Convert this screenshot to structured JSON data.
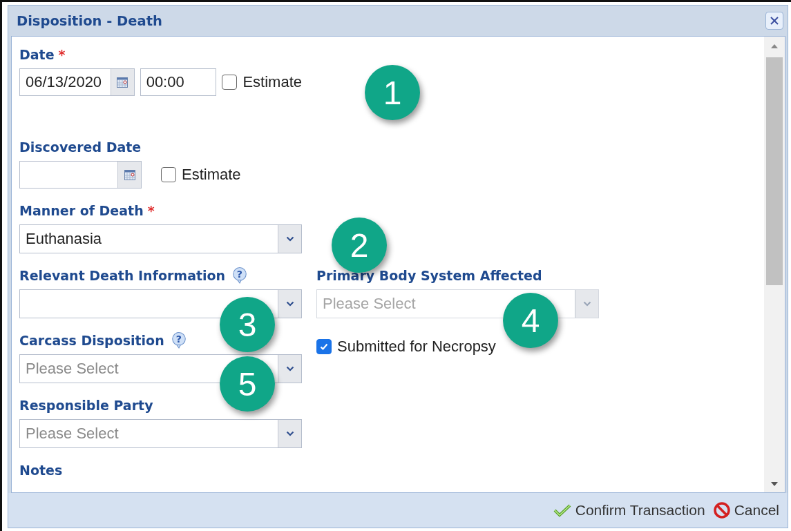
{
  "window": {
    "title": "Disposition - Death"
  },
  "rows": [
    {
      "fields": [
        {
          "kind": "datetime",
          "label": "Date",
          "required_mark": "*",
          "date": "06/13/2020",
          "time": "00:00",
          "estimate": {
            "label": "Estimate",
            "checked": false
          }
        }
      ]
    },
    {
      "fields": [
        {
          "kind": "date",
          "label": "Discovered Date",
          "estimate": {
            "label": "Estimate",
            "checked": false
          }
        }
      ]
    },
    {
      "fields": [
        {
          "kind": "select",
          "label": "Manner of Death",
          "required_mark": "*",
          "value": "Euthanasia",
          "disabled": false
        }
      ]
    },
    {
      "fields": [
        {
          "kind": "select",
          "label": "Relevant Death Information",
          "help": "?",
          "disabled": false
        },
        {
          "kind": "select",
          "label": "Primary Body System Affected",
          "placeholder": "Please Select",
          "disabled": true
        }
      ]
    },
    {
      "fields": [
        {
          "kind": "select",
          "label": "Carcass Disposition",
          "help": "?",
          "placeholder": "Please Select",
          "disabled": false
        },
        {
          "kind": "checkbox",
          "label": "Submitted for Necropsy",
          "checked": true
        }
      ]
    },
    {
      "fields": [
        {
          "kind": "select",
          "label": "Responsible Party",
          "placeholder": "Please Select",
          "disabled": false
        }
      ]
    },
    {
      "fields": [
        {
          "kind": "heading",
          "label": "Notes"
        }
      ]
    }
  ],
  "callouts": [
    {
      "number": "1"
    },
    {
      "number": "2"
    },
    {
      "number": "3"
    },
    {
      "number": "4"
    },
    {
      "number": "5"
    }
  ],
  "buttons": [
    {
      "kind": "confirm",
      "label": "Confirm Transaction"
    },
    {
      "kind": "cancel",
      "label": "Cancel"
    }
  ]
}
